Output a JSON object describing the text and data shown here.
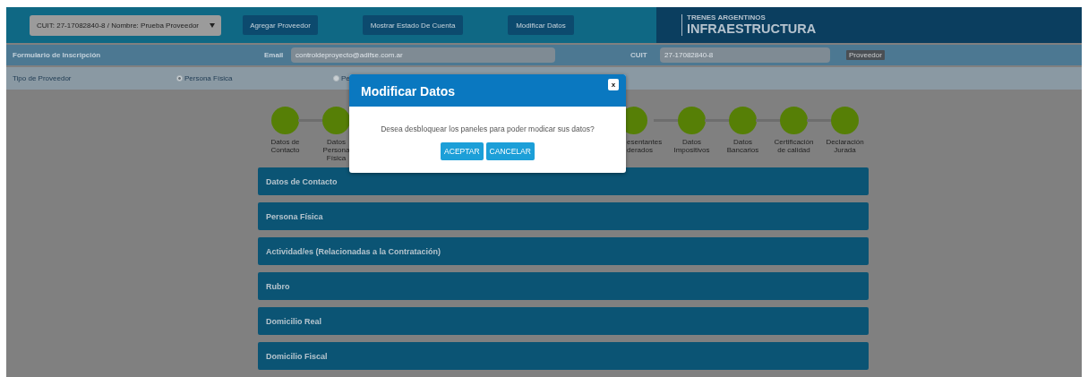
{
  "header": {
    "supplier_select": "CUIT: 27-17082840-8 / Nombre: Prueba Proveedor",
    "buttons": [
      "Agregar Proveedor",
      "Mostrar Estado De Cuenta",
      "Modificar Datos"
    ],
    "brand": {
      "line1": "TRENES ARGENTINOS",
      "line2": "INFRAESTRUCTURA"
    }
  },
  "form_bar": {
    "title": "Formulario de Inscripción",
    "email_label": "Email",
    "email_value": "controldeproyecto@adifse.com.ar",
    "cuit_label": "CUIT",
    "cuit_value": "27-17082840-8",
    "badge": "Proveedor"
  },
  "provider_type": {
    "label": "Tipo de Proveedor",
    "options": [
      {
        "label": "Persona Física",
        "selected": true
      },
      {
        "label": "Pe",
        "selected": false
      }
    ]
  },
  "steps_left": [
    {
      "label": "Datos de\nContacto"
    },
    {
      "label": "Datos\nPersona\nFísica"
    }
  ],
  "step_partial": {
    "label": "esentantes\nderados"
  },
  "steps_right": [
    {
      "label": "Datos\nImpositivos"
    },
    {
      "label": "Datos\nBancarios"
    },
    {
      "label": "Certificación\nde calidad"
    },
    {
      "label": "Declaración\nJurada"
    }
  ],
  "panels": [
    "Datos de Contacto",
    "Persona Física",
    "Actividad/es (Relacionadas a la Contratación)",
    "Rubro",
    "Domicilio Real",
    "Domicilio Fiscal"
  ],
  "modal": {
    "title": "Modificar Datos",
    "close": "x",
    "message": "Desea desbloquear los paneles para poder modicar sus datos?",
    "buttons": [
      "ACEPTAR",
      "CANCELAR"
    ]
  }
}
